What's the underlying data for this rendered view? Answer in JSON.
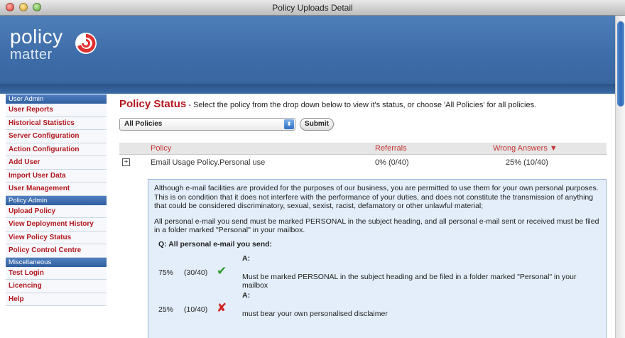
{
  "window": {
    "title": "Policy Uploads Detail"
  },
  "logo": {
    "line1": "policy",
    "line2": "matter"
  },
  "sidebar": {
    "sections": [
      {
        "header": "User Admin",
        "items": [
          "User Reports",
          "Historical Statistics",
          "Server Configuration",
          "Action Configuration",
          "Add User",
          "Import User Data",
          "User Management"
        ]
      },
      {
        "header": "Policy Admin",
        "items": [
          "Upload Policy",
          "View Deployment History",
          "View Policy Status",
          "Policy Control Centre"
        ]
      },
      {
        "header": "Miscellaneous",
        "items": [
          "Test Login",
          "Licencing",
          "Help"
        ]
      }
    ]
  },
  "main": {
    "title": "Policy Status",
    "description": " - Select the policy from the drop down below to view it's status, or choose 'All Policies' for all policies.",
    "select_value": "All Policies",
    "submit_label": "Submit",
    "table": {
      "headers": {
        "policy": "Policy",
        "referrals": "Referrals",
        "wrong": "Wrong Answers ▼"
      },
      "row": {
        "expand": "+",
        "policy": "Email Usage Policy.Personal use",
        "referrals": "0% (0/40)",
        "wrong": "25% (10/40)"
      }
    },
    "detail": {
      "para1": "Although e-mail facilities are provided for the purposes of our business, you are permitted to use them for your own personal purposes. This is on condition that it does not interfere with the performance of your duties, and does not constitute the transmission of anything that could be considered discriminatory, sexual, sexist, racist, defamatory or other unlawful material;",
      "para2": "All personal e-mail you send must be marked PERSONAL in the subject heading, and all personal e-mail sent or received must be filed in a folder marked \"Personal\" in your mailbox.",
      "question": "Q: All personal e-mail you send:",
      "answers": [
        {
          "label": "A:",
          "pct": "75%",
          "count": "(30/40)",
          "mark": "✔",
          "text": "Must be marked PERSONAL in the subject heading and be filed in a folder marked \"Personal\" in your mailbox"
        },
        {
          "label": "A:",
          "pct": "25%",
          "count": "(10/40)",
          "mark": "✘",
          "text": "must bear your own personalised disclaimer"
        }
      ]
    }
  },
  "colors": {
    "accent_red": "#b3181e",
    "banner_blue": "#3d6ca8",
    "detail_bg": "#e4eefa"
  }
}
